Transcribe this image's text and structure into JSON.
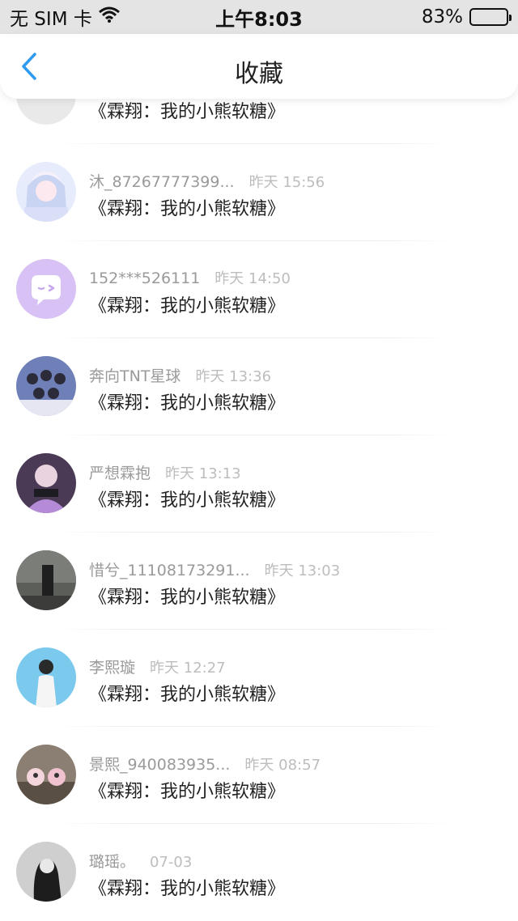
{
  "status_bar": {
    "carrier": "无 SIM 卡",
    "time": "上午8:03",
    "battery": "83%",
    "battery_level": 0.83
  },
  "nav": {
    "title": "收藏",
    "back_icon": "chevron-left-icon"
  },
  "items": [
    {
      "name": "",
      "time": "",
      "work": "《霖翔：我的小熊软糖》",
      "avatar": "pink-banner"
    },
    {
      "name": "沐_87267777399...",
      "time": "昨天 15:56",
      "work": "《霖翔：我的小熊软糖》",
      "avatar": "anime-girl"
    },
    {
      "name": "152***526111",
      "time": "昨天 14:50",
      "work": "《霖翔：我的小熊软糖》",
      "avatar": "default-purple"
    },
    {
      "name": "奔向TNT星球",
      "time": "昨天 13:36",
      "work": "《霖翔：我的小熊软糖》",
      "avatar": "group-photo"
    },
    {
      "name": "严想霖抱",
      "time": "昨天 13:13",
      "work": "《霖翔：我的小熊软糖》",
      "avatar": "purple-stage"
    },
    {
      "name": "惜兮_11108173291...",
      "time": "昨天 13:03",
      "work": "《霖翔：我的小熊软糖》",
      "avatar": "street-dark"
    },
    {
      "name": "李熙璇",
      "time": "昨天 12:27",
      "work": "《霖翔：我的小熊软糖》",
      "avatar": "blue-portrait"
    },
    {
      "name": "景熙_940083935...",
      "time": "昨天 08:57",
      "work": "《霖翔：我的小熊软糖》",
      "avatar": "toy-room"
    },
    {
      "name": "璐瑶。",
      "time": "07-03",
      "work": "《霖翔：我的小熊软糖》",
      "avatar": "bw-portrait"
    }
  ],
  "colors": {
    "accent": "#2f9bf0",
    "name_text": "#9a9a9a",
    "time_text": "#bdbdbd"
  }
}
